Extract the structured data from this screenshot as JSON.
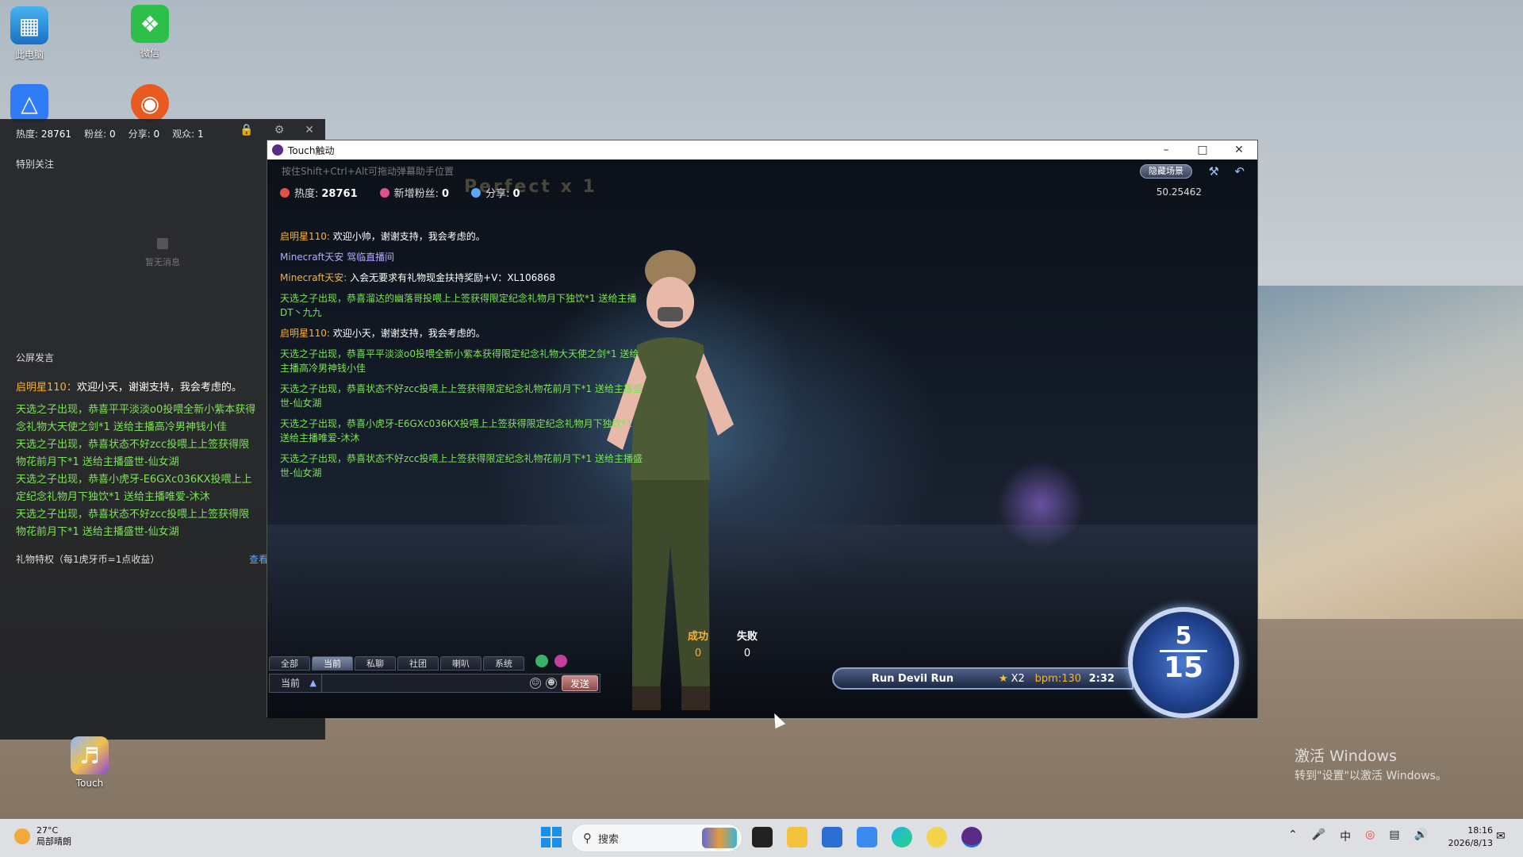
{
  "desktop": {
    "icons": [
      {
        "label": "此电脑"
      },
      {
        "label": "微信"
      },
      {
        "label": "Touch"
      }
    ]
  },
  "live_panel": {
    "stats": [
      {
        "label": "热度:",
        "value": "28761"
      },
      {
        "label": "粉丝:",
        "value": "0"
      },
      {
        "label": "分享:",
        "value": "0"
      },
      {
        "label": "观众:",
        "value": "1"
      }
    ],
    "special_follow_heading": "特别关注",
    "empty_message": "暂无消息",
    "public_heading": "公屏发言",
    "first_msg": {
      "name": "启明星110",
      "sep": "：",
      "text": "欢迎小天，谢谢支持，我会考虑的。"
    },
    "system_msgs": [
      "天选之子出现，恭喜平平淡淡o0投喂全新小紫本获得",
      "念礼物大天使之剑*1 送给主播高冷男神钱小佳",
      "天选之子出现，恭喜状态不好zcc投喂上上签获得限",
      "物花前月下*1 送给主播盛世-仙女湖",
      "天选之子出现，恭喜小虎牙-E6GXc036KX投喂上上",
      "定纪念礼物月下独饮*1 送给主播唯爱-沐沐",
      "天选之子出现，恭喜状态不好zcc投喂上上签获得限",
      "物花前月下*1 送给主播盛世-仙女湖"
    ],
    "gift_privilege": "礼物特权（每1虎牙币=1点收益）",
    "view_link": "查看"
  },
  "game_window": {
    "title": "Touch触动",
    "hint": "按住Shift+Ctrl+Alt可拖动弹幕助手位置",
    "perfect_text": "Perfect x 1",
    "stats": [
      {
        "label": "热度:",
        "value": "28761"
      },
      {
        "label": "新增粉丝:",
        "value": "0"
      },
      {
        "label": "分享:",
        "value": "0"
      }
    ],
    "hide_scene_label": "隐藏场景",
    "fps_readout": "50.25462",
    "chat_log": [
      {
        "kind": "user",
        "name": "启明星110",
        "sep": ":",
        "text": "欢迎小帅，谢谢支持，我会考虑的。"
      },
      {
        "kind": "sys2",
        "text": "Minecraft天安 驾临直播间"
      },
      {
        "kind": "user",
        "name": "Minecraft天安",
        "sep": ":",
        "text": "入会无要求有礼物现金扶持奖励+V：XL106868"
      },
      {
        "kind": "sys",
        "text": "天选之子出现，恭喜溜达的幽落哥投喂上上签获得限定纪念礼物月下独饮*1 送给主播DT丶九九"
      },
      {
        "kind": "user",
        "name": "启明星110",
        "sep": ":",
        "text": "欢迎小天，谢谢支持，我会考虑的。"
      },
      {
        "kind": "sys",
        "text": "天选之子出现，恭喜平平淡淡o0投喂全新小紫本获得限定纪念礼物大天使之剑*1 送给主播高冷男神钱小佳"
      },
      {
        "kind": "sys",
        "text": "天选之子出现，恭喜状态不好zcc投喂上上签获得限定纪念礼物花前月下*1 送给主播盛世-仙女湖"
      },
      {
        "kind": "sys",
        "text": "天选之子出现，恭喜小虎牙-E6GXc036KX投喂上上签获得限定纪念礼物月下独饮*1 送给主播唯爱-沐沐"
      },
      {
        "kind": "sys",
        "text": "天选之子出现，恭喜状态不好zcc投喂上上签获得限定纪念礼物花前月下*1 送给主播盛世-仙女湖"
      }
    ],
    "judge": {
      "success_label": "成功",
      "fail_label": "失败",
      "success_count": "0",
      "fail_count": "0"
    },
    "chat_tabs": [
      {
        "label": "全部"
      },
      {
        "label": "当前",
        "active": true
      },
      {
        "label": "私聊"
      },
      {
        "label": "社团"
      },
      {
        "label": "喇叭"
      },
      {
        "label": "系统"
      }
    ],
    "channel": "当前",
    "chat_input_value": "",
    "send_label": "发送",
    "song": {
      "name": "Run Devil Run",
      "multiplier": "X2",
      "bpm": "bpm:130",
      "time": "2:32"
    },
    "beat": {
      "current": "5",
      "total": "15"
    }
  },
  "watermark": {
    "title": "激活 Windows",
    "subtitle": "转到\"设置\"以激活 Windows。"
  },
  "taskbar": {
    "weather_temp": "27°C",
    "weather_desc": "局部晴朗",
    "search_placeholder": "搜索",
    "time": "18:16",
    "date": "2026/8/13"
  },
  "colors": {
    "accent_gold": "#f3b33a",
    "system_green": "#7ee35a",
    "link_blue": "#5ca8ff"
  }
}
